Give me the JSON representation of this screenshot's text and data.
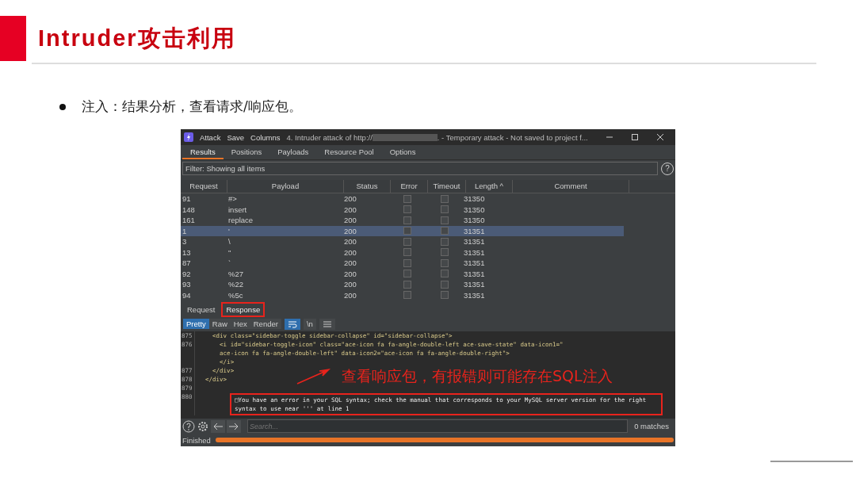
{
  "slide": {
    "title": "Intruder攻击利用",
    "bullet": "注入：结果分析，查看请求/响应包。"
  },
  "window": {
    "menu": [
      "Attack",
      "Save",
      "Columns"
    ],
    "title": "4. Intruder attack of http://",
    "title_rest": ". - Temporary attack - Not saved to project f...",
    "tabs": [
      {
        "label": "Results",
        "selected": true
      },
      {
        "label": "Positions",
        "selected": false
      },
      {
        "label": "Payloads",
        "selected": false
      },
      {
        "label": "Resource Pool",
        "selected": false
      },
      {
        "label": "Options",
        "selected": false
      }
    ],
    "filter": "Filter: Showing all items",
    "help": "?",
    "table": {
      "columns": [
        "Request",
        "Payload",
        "Status",
        "Error",
        "Timeout",
        "Length ^",
        "Comment"
      ],
      "rows": [
        {
          "request": "91",
          "payload": "#>",
          "status": "200",
          "error": false,
          "timeout": false,
          "length": "31350",
          "selected": false
        },
        {
          "request": "148",
          "payload": "insert",
          "status": "200",
          "error": false,
          "timeout": false,
          "length": "31350",
          "selected": false
        },
        {
          "request": "161",
          "payload": "replace",
          "status": "200",
          "error": false,
          "timeout": false,
          "length": "31350",
          "selected": false
        },
        {
          "request": "1",
          "payload": "'",
          "status": "200",
          "error": false,
          "timeout": false,
          "length": "31351",
          "selected": true
        },
        {
          "request": "3",
          "payload": "\\",
          "status": "200",
          "error": false,
          "timeout": false,
          "length": "31351",
          "selected": false
        },
        {
          "request": "13",
          "payload": "\"",
          "status": "200",
          "error": false,
          "timeout": false,
          "length": "31351",
          "selected": false
        },
        {
          "request": "87",
          "payload": "`",
          "status": "200",
          "error": false,
          "timeout": false,
          "length": "31351",
          "selected": false
        },
        {
          "request": "92",
          "payload": "%27",
          "status": "200",
          "error": false,
          "timeout": false,
          "length": "31351",
          "selected": false
        },
        {
          "request": "93",
          "payload": "%22",
          "status": "200",
          "error": false,
          "timeout": false,
          "length": "31351",
          "selected": false
        },
        {
          "request": "94",
          "payload": "%5c",
          "status": "200",
          "error": false,
          "timeout": false,
          "length": "31351",
          "selected": false
        }
      ]
    },
    "detail_tabs": [
      {
        "label": "Request",
        "selected": false,
        "highlighted": false
      },
      {
        "label": "Response",
        "selected": true,
        "highlighted": true
      }
    ],
    "view_tabs": [
      {
        "label": "Pretty",
        "selected": true
      },
      {
        "label": "Raw",
        "selected": false
      },
      {
        "label": "Hex",
        "selected": false
      },
      {
        "label": "Render",
        "selected": false
      }
    ],
    "view_toggles": [
      {
        "kind": "wrap",
        "selected": true
      },
      {
        "kind": "text",
        "label": "\\n",
        "selected": false
      },
      {
        "kind": "menu",
        "selected": false
      }
    ],
    "code": [
      {
        "number": "875",
        "text": "    <div class=\"sidebar-toggle sidebar-collapse\" id=\"sidebar-collapse\">"
      },
      {
        "number": "876",
        "text": "      <i id=\"sidebar-toggle-icon\" class=\"ace-icon fa fa-angle-double-left ace-save-state\" data-icon1=\""
      },
      {
        "text": "      ace-icon fa fa-angle-double-left\" data-icon2=\"ace-icon fa fa-angle-double-right\">"
      },
      {
        "text": "      </i>"
      },
      {
        "number": "877",
        "text": "    </div>"
      },
      {
        "number": "878",
        "text": "  </div>"
      },
      {
        "number": "879"
      },
      {
        "number": "880",
        "text": "□You have an error in your SQL syntax; check the manual that corresponds to your MySQL server version for the right syntax to use near ''' at line 1",
        "highlighted": true
      }
    ],
    "annotation": "查看响应包，有报错则可能存在SQL注入",
    "search": {
      "placeholder": "Search..."
    },
    "matches": "0 matches",
    "status": "Finished",
    "progress": {
      "level": 1.0
    }
  }
}
